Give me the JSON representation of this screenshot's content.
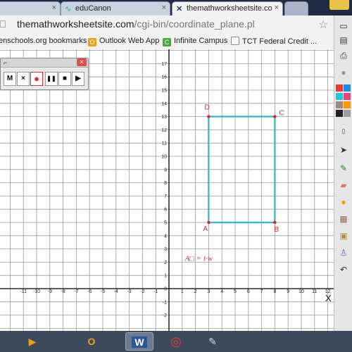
{
  "tabs": [
    {
      "label": "",
      "icon": "page-icon"
    },
    {
      "label": "eduCanon",
      "icon": "educanon-icon"
    },
    {
      "label": "themathworksheetsite.co",
      "icon": "tmws-icon",
      "active": true
    }
  ],
  "tab_close": "×",
  "address": {
    "host": "themathworksheetsite.com",
    "path": "/cgi-bin/coordinate_plane.pl"
  },
  "bookmarks": [
    {
      "label": "enschools.org bookmarks",
      "icon": "folder-icon"
    },
    {
      "label": "Outlook Web App",
      "icon": "outlook-icon",
      "icon_char": "O",
      "color": "#e8a317"
    },
    {
      "label": "Infinite Campus",
      "icon": "campus-icon",
      "icon_char": "C",
      "color": "#4aa641"
    },
    {
      "label": "TCT Federal Credit ...",
      "icon": "page-icon",
      "icon_char": "",
      "color": "#ffffff"
    }
  ],
  "recorder": {
    "buttons": [
      "M",
      "×",
      "●",
      "❚❚",
      "■",
      "▶"
    ],
    "close": "×"
  },
  "plane": {
    "x_ticks": [
      "-11",
      "-10",
      "-9",
      "-8",
      "-7",
      "-6",
      "-5",
      "-4",
      "-3",
      "-2",
      "-1",
      "0",
      "1",
      "2",
      "3",
      "4",
      "5",
      "6",
      "7",
      "8",
      "9",
      "10",
      "11",
      "12"
    ],
    "y_ticks": [
      "17",
      "16",
      "15",
      "14",
      "13",
      "12",
      "11",
      "10",
      "9",
      "8",
      "7",
      "6",
      "5",
      "4",
      "3",
      "2",
      "1",
      "0",
      "-1",
      "-2"
    ],
    "x_axis_label": "X",
    "rect_color": "#3fb8c8",
    "ink_color": "#d8262a",
    "points": [
      {
        "label": "A",
        "x": 3,
        "y": 5
      },
      {
        "label": "B",
        "x": 8,
        "y": 5
      },
      {
        "label": "C",
        "x": 8,
        "y": 13
      },
      {
        "label": "D",
        "x": 3,
        "y": 13
      }
    ],
    "formula": "A□ = l·w"
  },
  "toolbar": {
    "swatches": [
      "#e53935",
      "#1e88e5",
      "#26c6da",
      "#ec407a",
      "#a1887f",
      "#ff9800",
      "#212121",
      "#9e9e9e"
    ]
  },
  "taskbar": {
    "apps": [
      {
        "name": "media-app-icon",
        "glyph": "▶",
        "color": "#e67e22"
      },
      {
        "name": "outlook-task-icon",
        "glyph": "O",
        "color": "#f0a020"
      },
      {
        "name": "word-task-icon",
        "glyph": "W",
        "color": "#2b5797",
        "active": true
      },
      {
        "name": "chrome-task-icon",
        "glyph": "◎",
        "color": "#e53935"
      },
      {
        "name": "pen-task-icon",
        "glyph": "✎",
        "color": "#cfd8dc"
      }
    ]
  }
}
